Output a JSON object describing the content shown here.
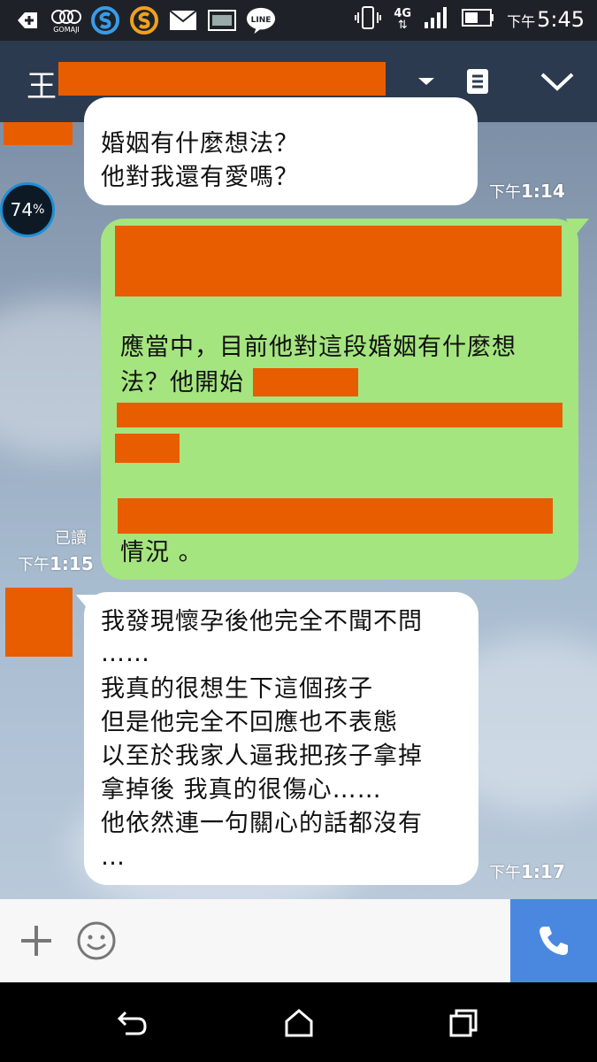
{
  "status_bar": {
    "clock_prefix": "下午",
    "clock": "5:45",
    "network_label": "4G",
    "app_icons": [
      "add-icon",
      "gomaji-icon",
      "s-app-icon",
      "s-app-icon-2",
      "mail-icon",
      "image-icon",
      "line-icon"
    ],
    "gomaji_label": "GOMAJI",
    "line_label": "LINE"
  },
  "header": {
    "chat_title_visible": "王"
  },
  "battery_overlay": {
    "value": "74",
    "unit": "%"
  },
  "messages": [
    {
      "side": "left",
      "lines": [
        "婚姻有什麼想法？",
        "他對我還有愛嗎？"
      ],
      "time_prefix": "下午",
      "time": "1:14"
    },
    {
      "side": "right",
      "lines": [
        "應當中，目前他對這段婚姻有什麼想",
        "法？他開始",
        "情況 。"
      ],
      "read_label": "已讀",
      "time_prefix": "下午",
      "time": "1:15"
    },
    {
      "side": "left",
      "lines": [
        "我發現懷孕後他完全不聞不問",
        "……",
        "我真的很想生下這個孩子",
        "但是他完全不回應也不表態",
        "以至於我家人逼我把孩子拿掉",
        "拿掉後 我真的很傷心……",
        "他依然連一句關心的話都沒有",
        "…"
      ],
      "time_prefix": "下午",
      "time": "1:17"
    }
  ],
  "colors": {
    "header_bg": "#2c3a4f",
    "bubble_green": "#a5e57f",
    "bubble_white": "#ffffff",
    "redaction": "#e85d00",
    "call_button": "#4a88e0"
  }
}
